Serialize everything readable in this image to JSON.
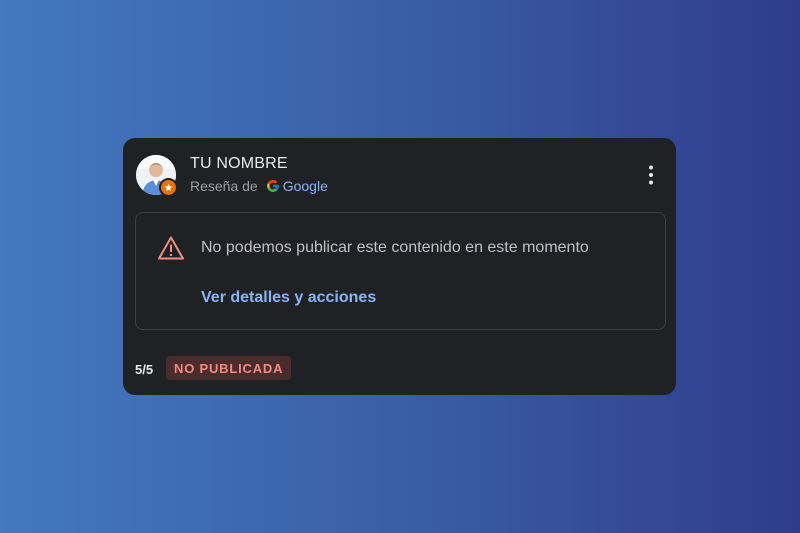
{
  "review": {
    "reviewer_name": "TU NOMBRE",
    "source_prefix": "Reseña de",
    "source_name": "Google",
    "rating": "5/5",
    "status_badge": "NO PUBLICADA"
  },
  "notice": {
    "message": "No podemos publicar este contenido en este momento",
    "link_label": "Ver detalles y acciones"
  },
  "icons": {
    "menu": "more-vert-icon",
    "warning": "warning-icon",
    "logo": "google-g-icon",
    "badge": "local-guide-badge-icon"
  },
  "colors": {
    "card_bg": "#202124",
    "link": "#8ab4f8",
    "warning": "#f28b82",
    "badge": "#e8710a",
    "status_bg": "#4a2c2d"
  }
}
